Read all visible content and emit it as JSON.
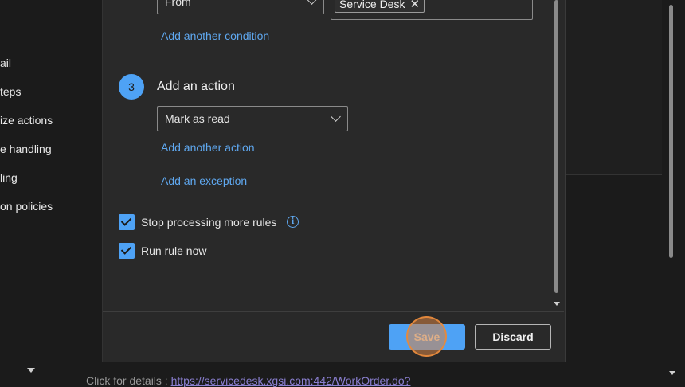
{
  "nav": {
    "items": [
      "ail",
      "teps",
      "ize actions",
      "e handling",
      "ling",
      "on policies"
    ]
  },
  "condition": {
    "field_selected": "From",
    "value_chip": "Service Desk",
    "add_condition_link": "Add another condition"
  },
  "action_step": {
    "number": "3",
    "title": "Add an action",
    "action_selected": "Mark as read",
    "add_action_link": "Add another action",
    "add_exception_link": "Add an exception"
  },
  "options": {
    "stop_processing": {
      "label": "Stop processing more rules",
      "checked": true
    },
    "run_now": {
      "label": "Run rule now",
      "checked": true
    }
  },
  "buttons": {
    "save": "Save",
    "discard": "Discard"
  },
  "background": {
    "email_text": "Click for details : ",
    "email_link": "https://servicedesk.xgsi.com:442/WorkOrder.do?"
  },
  "colors": {
    "accent": "#4ea2f5",
    "link": "#5fa8f0",
    "dialog_bg": "#292929",
    "page_bg": "#1b1b1b",
    "highlight": "#d68446"
  }
}
